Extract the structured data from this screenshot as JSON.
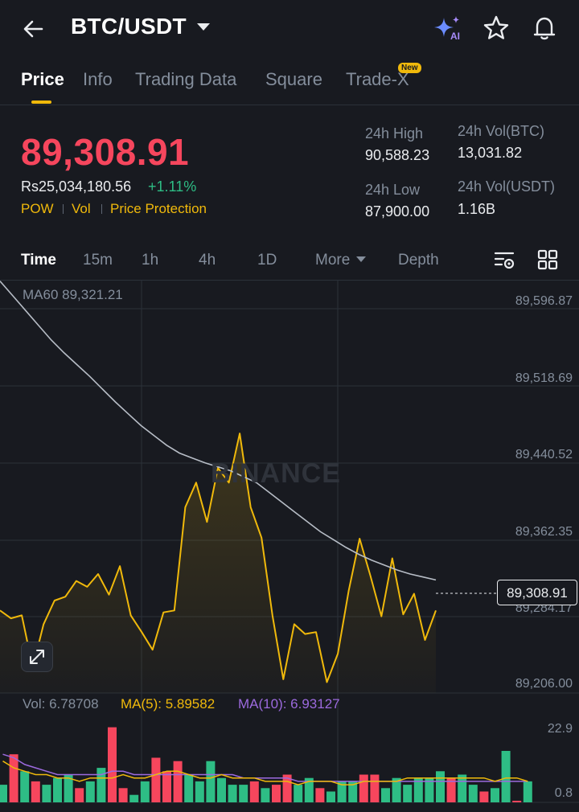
{
  "header": {
    "pair": "BTC/USDT",
    "icons": [
      "back-arrow-icon",
      "ai-sparkle-icon",
      "star-icon",
      "bell-icon"
    ],
    "ai_label": "AI"
  },
  "tabs": [
    {
      "label": "Price",
      "active": true
    },
    {
      "label": "Info"
    },
    {
      "label": "Trading Data"
    },
    {
      "label": "Square"
    },
    {
      "label": "Trade-X",
      "badge": "New"
    }
  ],
  "price": {
    "last": "89,308.91",
    "fiat": "Rs25,034,180.56",
    "change": "+1.11%",
    "tags": [
      "POW",
      "Vol",
      "Price Protection"
    ]
  },
  "stats": {
    "high_label": "24h High",
    "high_value": "90,588.23",
    "low_label": "24h Low",
    "low_value": "87,900.00",
    "vol_btc_label": "24h Vol(BTC)",
    "vol_btc_value": "13,031.82",
    "vol_usdt_label": "24h Vol(USDT)",
    "vol_usdt_value": "1.16B"
  },
  "intervals": [
    "Time",
    "15m",
    "1h",
    "4h",
    "1D",
    "More",
    "Depth"
  ],
  "chart": {
    "ma60_label": "MA60 89,321.21",
    "watermark": "BINANCE",
    "axis": [
      "89,596.87",
      "89,518.69",
      "89,440.52",
      "89,362.35",
      "89,284.17",
      "89,206.00"
    ],
    "last_price_tag": "89,308.91",
    "vol_label": "Vol: 6.78708",
    "ma5_label": "MA(5): 5.89582",
    "ma10_label": "MA(10): 6.93127",
    "vol_axis_top": "22.9",
    "vol_axis_bottom": "0.8",
    "colors": {
      "line": "#f0b90b",
      "ma60": "#b7bdc6",
      "up": "#2ebd85",
      "down": "#f6465d",
      "ma5": "#f0b90b",
      "ma10": "#9c6ade"
    }
  },
  "chart_data": {
    "type": "line",
    "ylim": [
      89206.0,
      89596.87
    ],
    "series": [
      {
        "values": [
          89290,
          89282,
          89285,
          89232,
          89276,
          89300,
          89304,
          89320,
          89314,
          89327,
          89306,
          89335,
          89285,
          89268,
          89250,
          89288,
          89290,
          89395,
          89420,
          89380,
          89435,
          89420,
          89470,
          89395,
          89364,
          89285,
          89220,
          89276,
          89266,
          89268,
          89217,
          89246,
          89310,
          89363,
          89325,
          89284,
          89343,
          89286,
          89307,
          89260,
          89290
        ]
      },
      {
        "values": [
          89625,
          89610,
          89595,
          89580,
          89565,
          89552,
          89540,
          89528,
          89515,
          89502,
          89490,
          89478,
          89468,
          89458,
          89450,
          89445,
          89440,
          89436,
          89432,
          89426,
          89420,
          89410,
          89400,
          89390,
          89380,
          89370,
          89362,
          89354,
          89347,
          89341,
          89336,
          89331,
          89327,
          89324,
          89321
        ]
      }
    ],
    "volume": {
      "values": [
        6,
        15,
        10,
        7,
        6,
        8,
        9,
        5,
        7,
        11,
        23,
        5,
        3,
        7,
        14,
        10,
        13,
        9,
        7,
        13,
        8,
        6,
        6,
        7,
        5,
        6,
        9,
        6,
        8,
        5,
        4,
        7,
        7,
        9,
        9,
        5,
        8,
        6,
        8,
        8,
        10,
        8,
        9,
        6,
        4,
        5,
        16,
        1,
        7
      ],
      "up": [
        1,
        0,
        1,
        0,
        1,
        1,
        1,
        0,
        1,
        1,
        0,
        0,
        1,
        1,
        0,
        0,
        0,
        1,
        1,
        1,
        1,
        1,
        1,
        0,
        1,
        0,
        0,
        1,
        1,
        0,
        1,
        1,
        1,
        0,
        0,
        1,
        1,
        1,
        1,
        1,
        1,
        0,
        1,
        1,
        0,
        1,
        1,
        0,
        1
      ],
      "ma5": [
        13,
        11,
        10,
        9,
        9,
        8,
        8,
        7,
        8,
        8,
        8,
        9,
        8,
        8,
        9,
        10,
        10,
        9,
        8,
        8,
        9,
        8,
        8,
        8,
        7,
        7,
        7,
        6,
        7,
        7,
        7,
        6,
        6,
        7,
        7,
        7,
        7,
        8,
        8,
        8,
        8,
        8,
        8,
        8,
        8,
        7,
        8,
        8,
        7
      ],
      "ma10": [
        15,
        14,
        12,
        11,
        10,
        9,
        9,
        9,
        9,
        9,
        10,
        10,
        9,
        9,
        9,
        9,
        9,
        9,
        9,
        9,
        9,
        9,
        8,
        8,
        8,
        8,
        8,
        7,
        7,
        7,
        7,
        7,
        7,
        7,
        7,
        7,
        7,
        7,
        7,
        7,
        7,
        7,
        7,
        7,
        7,
        7,
        7,
        7,
        7
      ],
      "ylim": [
        0.8,
        22.9
      ]
    }
  }
}
